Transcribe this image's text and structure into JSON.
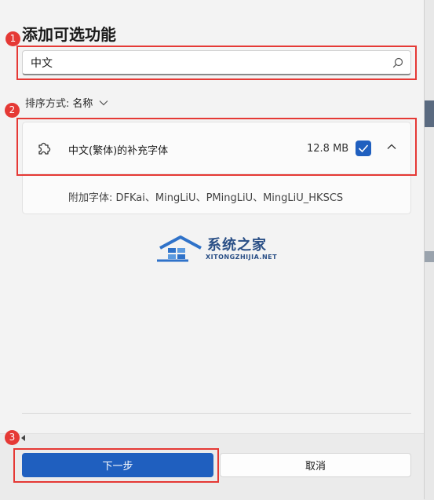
{
  "dialog": {
    "title": "添加可选功能",
    "search": {
      "value": "中文",
      "placeholder": ""
    },
    "sort": {
      "label": "排序方式:",
      "value": "名称"
    },
    "feature": {
      "name": "中文(繁体)的补充字体",
      "size": "12.8 MB",
      "checked": true,
      "details": "附加字体: DFKai、MingLiU、PMingLiU、MingLiU_HKSCS"
    },
    "buttons": {
      "next": "下一步",
      "cancel": "取消"
    }
  },
  "watermark": {
    "text_cn": "系统之家",
    "text_en": "XITONGZHIJIA.NET"
  },
  "annotations": [
    "1",
    "2",
    "3"
  ],
  "colors": {
    "accent": "#1f5fbf",
    "highlight": "#e53935",
    "watermark": "#2a4f86"
  }
}
